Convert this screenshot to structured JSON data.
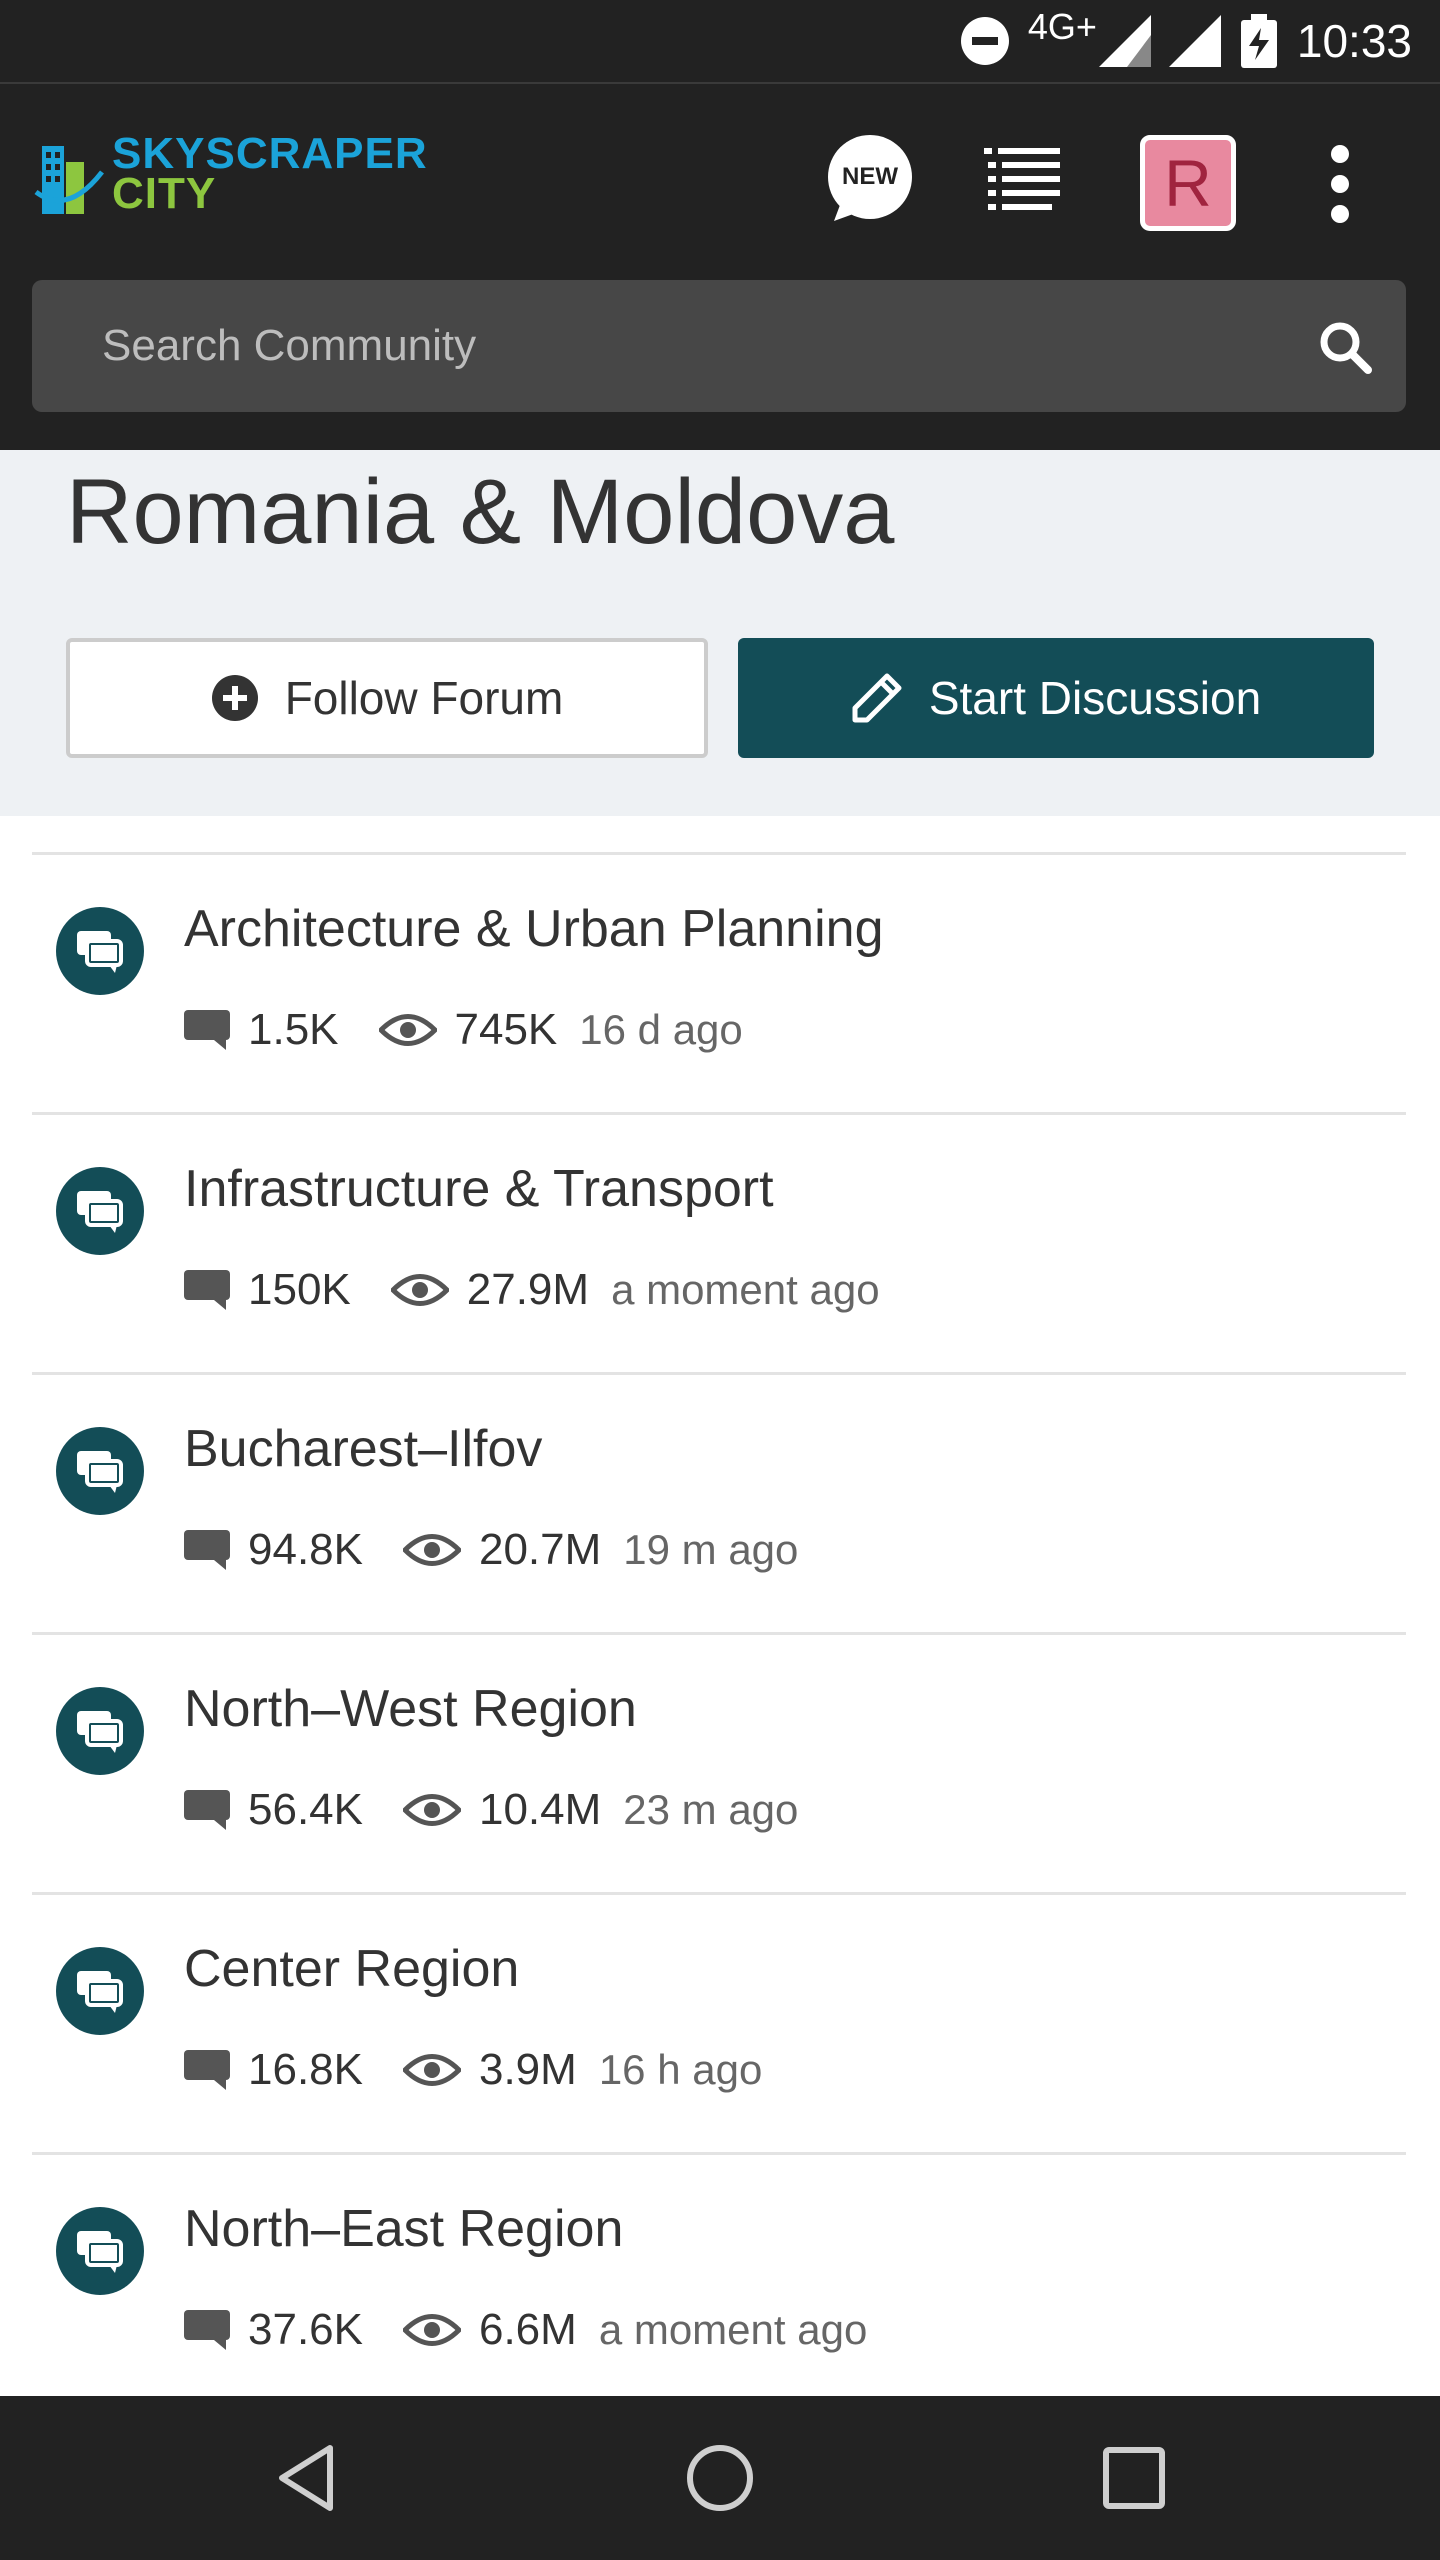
{
  "status_bar": {
    "network": "4G+",
    "time": "10:33"
  },
  "header": {
    "logo_line1": "SKYSCRAPER",
    "logo_line2": "CITY",
    "new_badge": "NEW",
    "avatar_letter": "R",
    "search_placeholder": "Search Community"
  },
  "page": {
    "title": "Romania & Moldova",
    "follow_label": "Follow Forum",
    "start_label": "Start Discussion"
  },
  "forums": [
    {
      "title": "Architecture & Urban Planning",
      "posts": "1.5K",
      "views": "745K",
      "time": "16 d ago"
    },
    {
      "title": "Infrastructure & Transport",
      "posts": "150K",
      "views": "27.9M",
      "time": "a moment ago"
    },
    {
      "title": "Bucharest–Ilfov",
      "posts": "94.8K",
      "views": "20.7M",
      "time": "19 m ago"
    },
    {
      "title": "North–West Region",
      "posts": "56.4K",
      "views": "10.4M",
      "time": "23 m ago"
    },
    {
      "title": "Center Region",
      "posts": "16.8K",
      "views": "3.9M",
      "time": "16 h ago"
    },
    {
      "title": "North–East Region",
      "posts": "37.6K",
      "views": "6.6M",
      "time": "a moment ago"
    }
  ],
  "colors": {
    "accent": "#134d57",
    "bar": "#222222",
    "header_bg": "#eef1f4"
  }
}
